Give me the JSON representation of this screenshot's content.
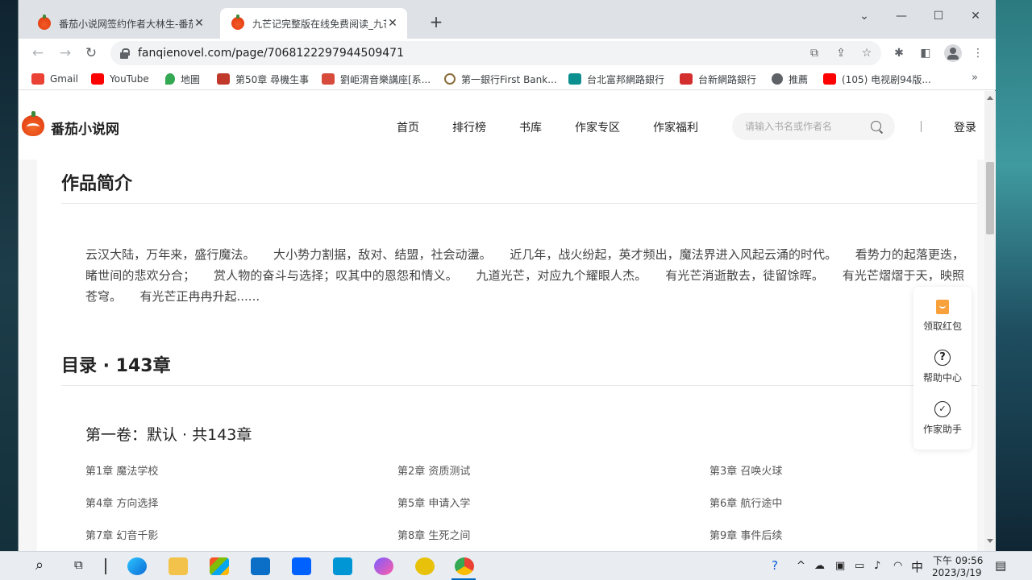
{
  "browser": {
    "tabs": [
      {
        "title": "番茄小说网签约作者大林生-番茄",
        "active": false
      },
      {
        "title": "九芒记完整版在线免费阅读_九芒",
        "active": true
      }
    ],
    "new_tab": "+",
    "window_controls": {
      "minimize": "—",
      "maximize": "☐",
      "close": "✕",
      "menu": "⌄"
    },
    "url": "fanqienovel.com/page/7068122297944509471",
    "bookmarks": [
      {
        "label": "Gmail",
        "color": "#ea4335"
      },
      {
        "label": "YouTube",
        "color": "#ff0000"
      },
      {
        "label": "地圖",
        "color": "#34a853"
      },
      {
        "label": "第50章 尋機生事",
        "color": "#c0392b"
      },
      {
        "label": "劉岠渭音樂講座[系...",
        "color": "#d64b3b"
      },
      {
        "label": "第一銀行First Bank...",
        "color": "#8a6d3b"
      },
      {
        "label": "台北富邦網路銀行",
        "color": "#0b8f8f"
      },
      {
        "label": "台新網路銀行",
        "color": "#d32f2f"
      },
      {
        "label": "推薦",
        "color": "#5f6368"
      },
      {
        "label": "(105) 电视剧94版...",
        "color": "#ff0000"
      }
    ],
    "bookmarks_more": "»"
  },
  "site": {
    "logo_text": "番茄小说网",
    "nav": [
      "首页",
      "排行榜",
      "书库",
      "作家专区",
      "作家福利"
    ],
    "search_placeholder": "请输入书名或作者名",
    "divider": "|",
    "login": "登录"
  },
  "book": {
    "intro_title": "作品简介",
    "intro_text": "云汉大陆，万年来，盛行魔法。　　大小势力割据，敌对、结盟，社会动盪。　　近几年，战火纷起，英才频出，魔法界进入风起云涌的时代。　　看势力的起落更迭，睹世间的悲欢分合；　　赏人物的奋斗与选择；叹其中的恩怨和情义。　　九道光芒，对应九个耀眼人杰。　　有光芒消逝散去，徒留馀晖。　　有光芒熠熠于天，映照苍穹。　　有光芒正冉冉升起......",
    "toc_title": "目录 · 143章",
    "volume_title": "第一卷：默认 · 共143章",
    "chapters": [
      "第1章 魔法学校",
      "第2章 资质测试",
      "第3章 召唤火球",
      "第4章 方向选择",
      "第5章 申请入学",
      "第6章 航行途中",
      "第7章 幻音千影",
      "第8章 生死之间",
      "第9章 事件后续"
    ]
  },
  "float_panel": [
    {
      "label": "领取红包",
      "icon": "red-packet-icon"
    },
    {
      "label": "帮助中心",
      "icon": "help-icon"
    },
    {
      "label": "作家助手",
      "icon": "writer-assistant-icon"
    }
  ],
  "taskbar": {
    "ime": "中",
    "time": "下午 09:56",
    "date": "2023/3/19"
  },
  "colors": {
    "brand": "#e84a18",
    "text": "#222222"
  }
}
